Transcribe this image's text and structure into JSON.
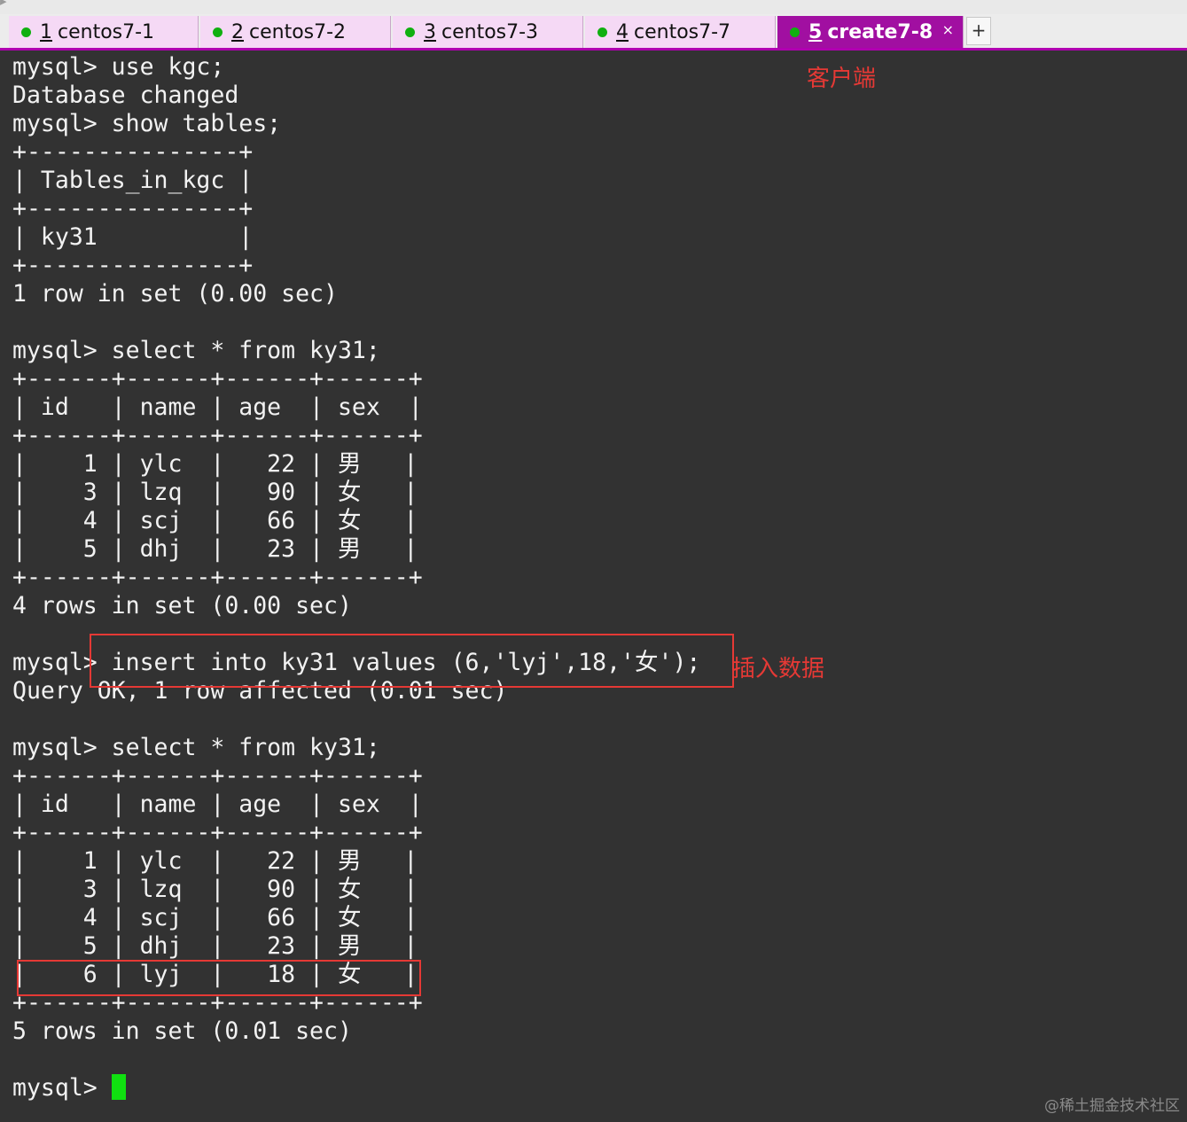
{
  "tabs": [
    {
      "num": "1",
      "title": "centos7-1"
    },
    {
      "num": "2",
      "title": "centos7-2"
    },
    {
      "num": "3",
      "title": "centos7-3"
    },
    {
      "num": "4",
      "title": "centos7-7"
    },
    {
      "num": "5",
      "title": "create7-8",
      "close": "×"
    }
  ],
  "new_tab_label": "+",
  "terminal": {
    "lines": [
      "mysql> use kgc;",
      "Database changed",
      "mysql> show tables;",
      "+---------------+",
      "| Tables_in_kgc |",
      "+---------------+",
      "| ky31          |",
      "+---------------+",
      "1 row in set (0.00 sec)",
      "",
      "mysql> select * from ky31;",
      "+------+------+------+------+",
      "| id   | name | age  | sex  |",
      "+------+------+------+------+",
      "|    1 | ylc  |   22 | 男   |",
      "|    3 | lzq  |   90 | 女   |",
      "|    4 | scj  |   66 | 女   |",
      "|    5 | dhj  |   23 | 男   |",
      "+------+------+------+------+",
      "4 rows in set (0.00 sec)",
      "",
      "mysql> insert into ky31 values (6,'lyj',18,'女');",
      "Query OK, 1 row affected (0.01 sec)",
      "",
      "mysql> select * from ky31;",
      "+------+------+------+------+",
      "| id   | name | age  | sex  |",
      "+------+------+------+------+",
      "|    1 | ylc  |   22 | 男   |",
      "|    3 | lzq  |   90 | 女   |",
      "|    4 | scj  |   66 | 女   |",
      "|    5 | dhj  |   23 | 男   |",
      "|    6 | lyj  |   18 | 女   |",
      "+------+------+------+------+",
      "5 rows in set (0.01 sec)",
      ""
    ],
    "prompt": "mysql> "
  },
  "annotations": {
    "client_label": "客户端",
    "insert_label": "插入数据",
    "color": "#e53935"
  },
  "watermark": "@稀土掘金技术社区"
}
